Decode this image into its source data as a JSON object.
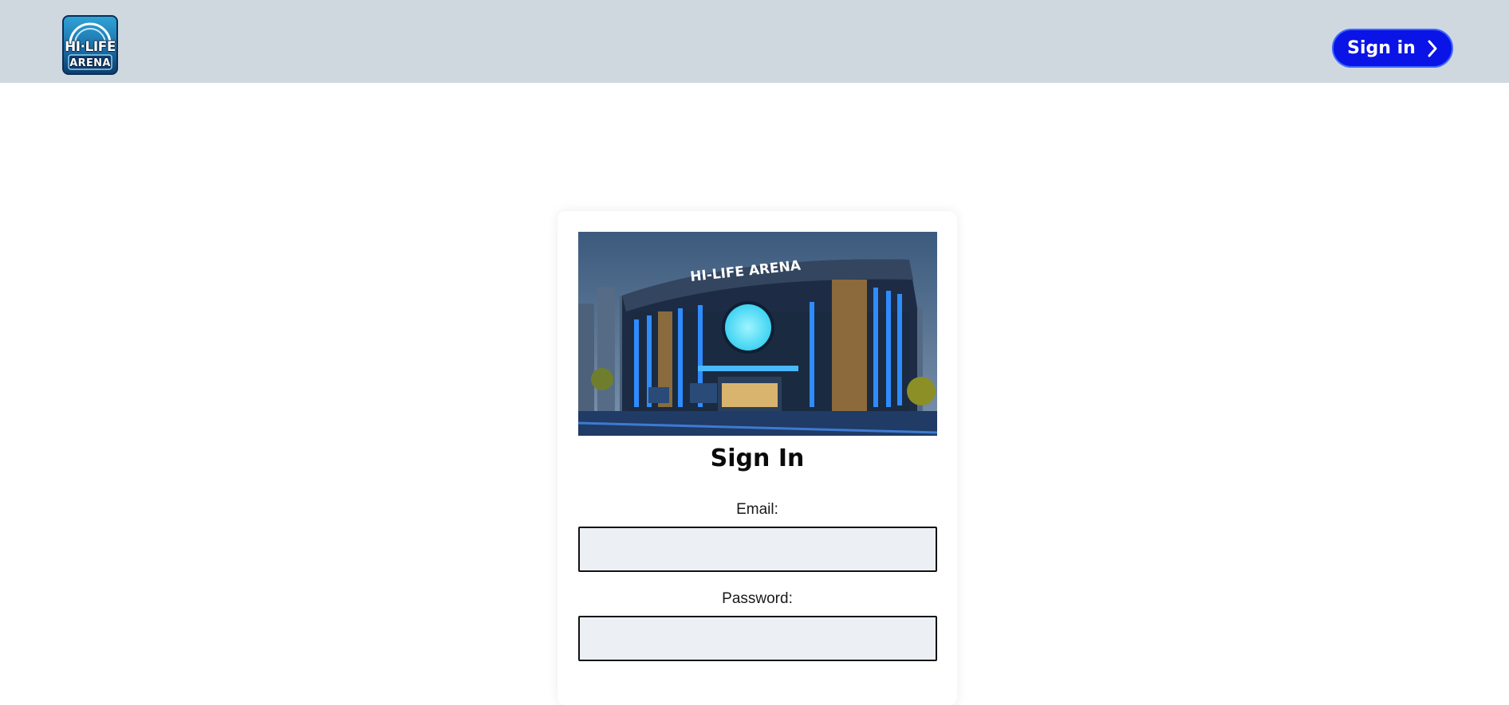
{
  "header": {
    "logo": {
      "line1": "HI·LIFE",
      "line2": "ARENA",
      "icon": "arena-logo-icon"
    },
    "signin_button": {
      "label": "Sign in",
      "icon": "chevron-right-icon"
    },
    "background_color": "#cfd8df",
    "button_color": "#0a14e6"
  },
  "card": {
    "hero_image": {
      "sign_text": "HI-LIFE ARENA",
      "icon": "arena-building-image"
    },
    "title": "Sign In",
    "email": {
      "label": "Email:",
      "value": "",
      "placeholder": ""
    },
    "password": {
      "label": "Password:",
      "value": "",
      "placeholder": ""
    },
    "input_background": "#ecf0f4"
  }
}
